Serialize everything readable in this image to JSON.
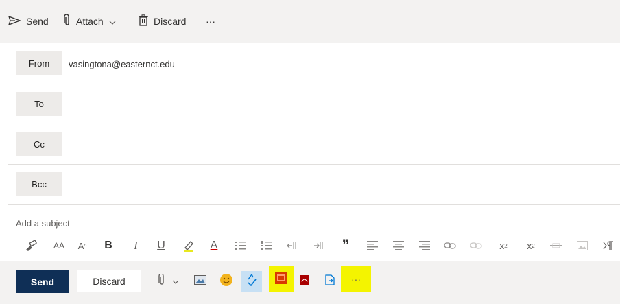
{
  "commandbar": {
    "send_label": "Send",
    "attach_label": "Attach",
    "discard_label": "Discard",
    "more_label": "···"
  },
  "fields": {
    "from_label": "From",
    "from_value": "vasingtona@easternct.edu",
    "to_label": "To",
    "cc_label": "Cc",
    "bcc_label": "Bcc"
  },
  "subject": {
    "placeholder": "Add a subject"
  },
  "format_toolbar": {
    "bold": "B",
    "italic": "I",
    "underline": "U",
    "font_color": "A",
    "quote": "”",
    "superscript": "x",
    "subscript": "x",
    "font_size_label": "AA",
    "grow_font_label": "A"
  },
  "actionbar": {
    "send_label": "Send",
    "discard_label": "Discard",
    "more_label": "···"
  },
  "colors": {
    "send_button": "#0f2f56",
    "highlight": "#f4f400",
    "toolbar_bg": "#f3f2f1",
    "label_bg": "#edebe9"
  },
  "icons": [
    "send-icon",
    "paperclip-icon",
    "chevron-down-icon",
    "trash-icon",
    "more-icon",
    "format-painter-icon",
    "font-size-icon",
    "grow-font-icon",
    "highlighter-icon",
    "bullets-icon",
    "numbering-icon",
    "decrease-indent-icon",
    "increase-indent-icon",
    "quote-icon",
    "align-left-icon",
    "align-center-icon",
    "align-right-icon",
    "link-icon",
    "unlink-icon",
    "strikethrough-icon",
    "image-icon",
    "paragraph-icon",
    "emoji-icon",
    "spell-check-icon",
    "office-addin-icon",
    "pdf-icon",
    "signature-icon"
  ]
}
